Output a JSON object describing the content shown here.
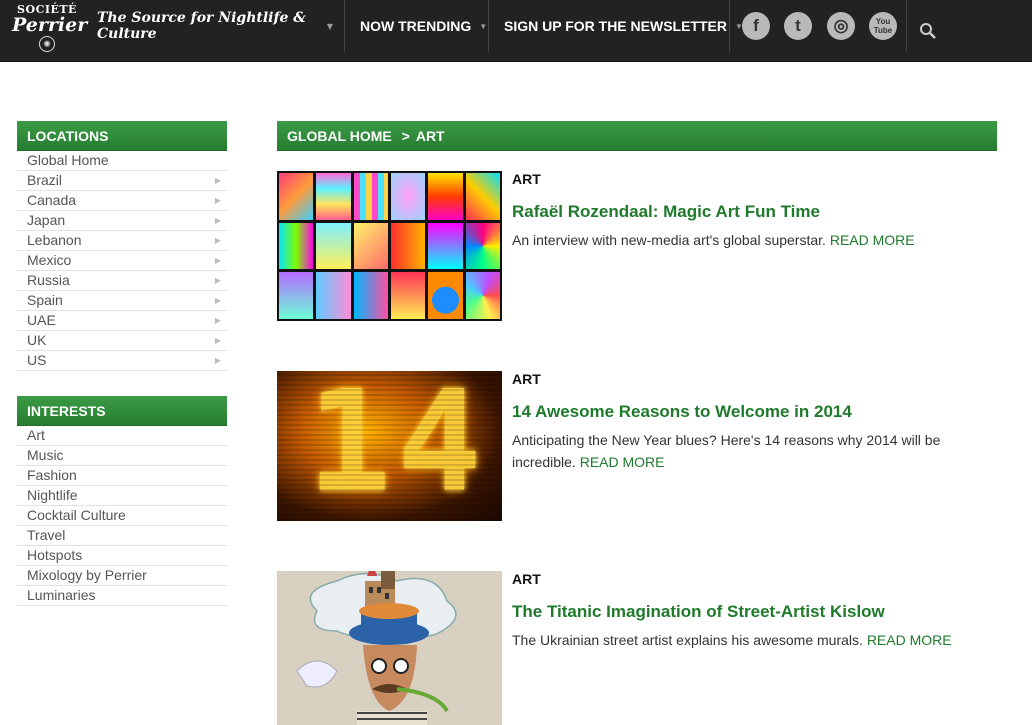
{
  "header": {
    "logo_line1": "SOCIÉTÉ",
    "logo_line2": "Perrier",
    "tagline": "The Source for Nightlife & Culture",
    "nav": [
      {
        "label": "NOW TRENDING"
      },
      {
        "label": "SIGN UP FOR THE NEWSLETTER"
      }
    ],
    "social": {
      "facebook": "f",
      "twitter": "t",
      "instagram": "◎",
      "youtube_line1": "You",
      "youtube_line2": "Tube"
    }
  },
  "sidebar": {
    "locations_title": "LOCATIONS",
    "locations": [
      {
        "label": "Global Home"
      },
      {
        "label": "Brazil"
      },
      {
        "label": "Canada"
      },
      {
        "label": "Japan"
      },
      {
        "label": "Lebanon"
      },
      {
        "label": "Mexico"
      },
      {
        "label": "Russia"
      },
      {
        "label": "Spain"
      },
      {
        "label": "UAE"
      },
      {
        "label": "UK"
      },
      {
        "label": "US"
      }
    ],
    "interests_title": "INTERESTS",
    "interests": [
      {
        "label": "Art"
      },
      {
        "label": "Music"
      },
      {
        "label": "Fashion"
      },
      {
        "label": "Nightlife"
      },
      {
        "label": "Cocktail Culture"
      },
      {
        "label": "Travel"
      },
      {
        "label": "Hotspots"
      },
      {
        "label": "Mixology by Perrier"
      },
      {
        "label": "Luminaries"
      }
    ]
  },
  "breadcrumb": {
    "home": "GLOBAL HOME",
    "sep": ">",
    "current": "ART"
  },
  "articles": [
    {
      "category": "ART",
      "title": "Rafaël Rozendaal: Magic Art Fun Time",
      "description": "An interview with new-media art's global superstar.",
      "read_more": "READ MORE"
    },
    {
      "category": "ART",
      "title": "14 Awesome Reasons to Welcome in 2014",
      "description": "Anticipating the New Year blues? Here's 14 reasons why 2014 will be incredible.",
      "read_more": "READ MORE"
    },
    {
      "category": "ART",
      "title": "The Titanic Imagination of Street-Artist Kislow",
      "description": "The Ukrainian street artist explains his awesome murals.",
      "read_more": "READ MORE"
    }
  ],
  "thumb2_text": "14",
  "colors": {
    "brand_green": "#2b8a36",
    "link_green": "#1f7a2c",
    "topbar": "#222222"
  }
}
